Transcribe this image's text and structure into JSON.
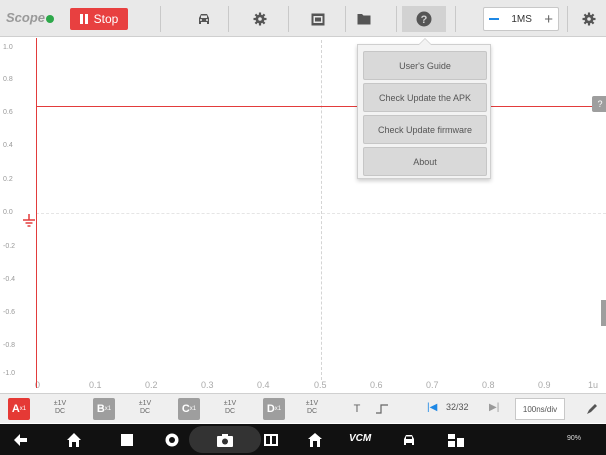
{
  "app": {
    "logo_text": "Scope",
    "stop_label": "Stop"
  },
  "toolbar": {
    "icons": [
      "car-icon",
      "gear-icon",
      "screen-icon",
      "folder-icon",
      "help-icon"
    ],
    "timebase": "1MS"
  },
  "plot": {
    "y_ticks": [
      "1.0",
      "0.8",
      "0.6",
      "0.4",
      "0.2",
      "0.0",
      "-0.2",
      "-0.4",
      "-0.6",
      "-0.8",
      "-1.0"
    ],
    "x_ticks": [
      "0",
      "0.1",
      "0.2",
      "0.3",
      "0.4",
      "0.5",
      "0.6",
      "0.7",
      "0.8",
      "0.9",
      "1u"
    ],
    "trace_color": "#e23b3b"
  },
  "help_menu": {
    "items": [
      "User's Guide",
      "Check Update the APK",
      "Check Update firmware",
      "About"
    ]
  },
  "channels": [
    {
      "letter": "A",
      "range": "±1V",
      "coupling": "DC",
      "color": "#e53935"
    },
    {
      "letter": "B",
      "range": "±1V",
      "coupling": "DC",
      "color": "#9e9e9e"
    },
    {
      "letter": "C",
      "range": "±1V",
      "coupling": "DC",
      "color": "#9e9e9e"
    },
    {
      "letter": "D",
      "range": "±1V",
      "coupling": "DC",
      "color": "#9e9e9e"
    }
  ],
  "bottom": {
    "trigger_t": "T",
    "page": "32/32",
    "per_div": "100ns/div"
  },
  "navbar": {
    "vci_label": "VCM",
    "status_text": "90%"
  }
}
